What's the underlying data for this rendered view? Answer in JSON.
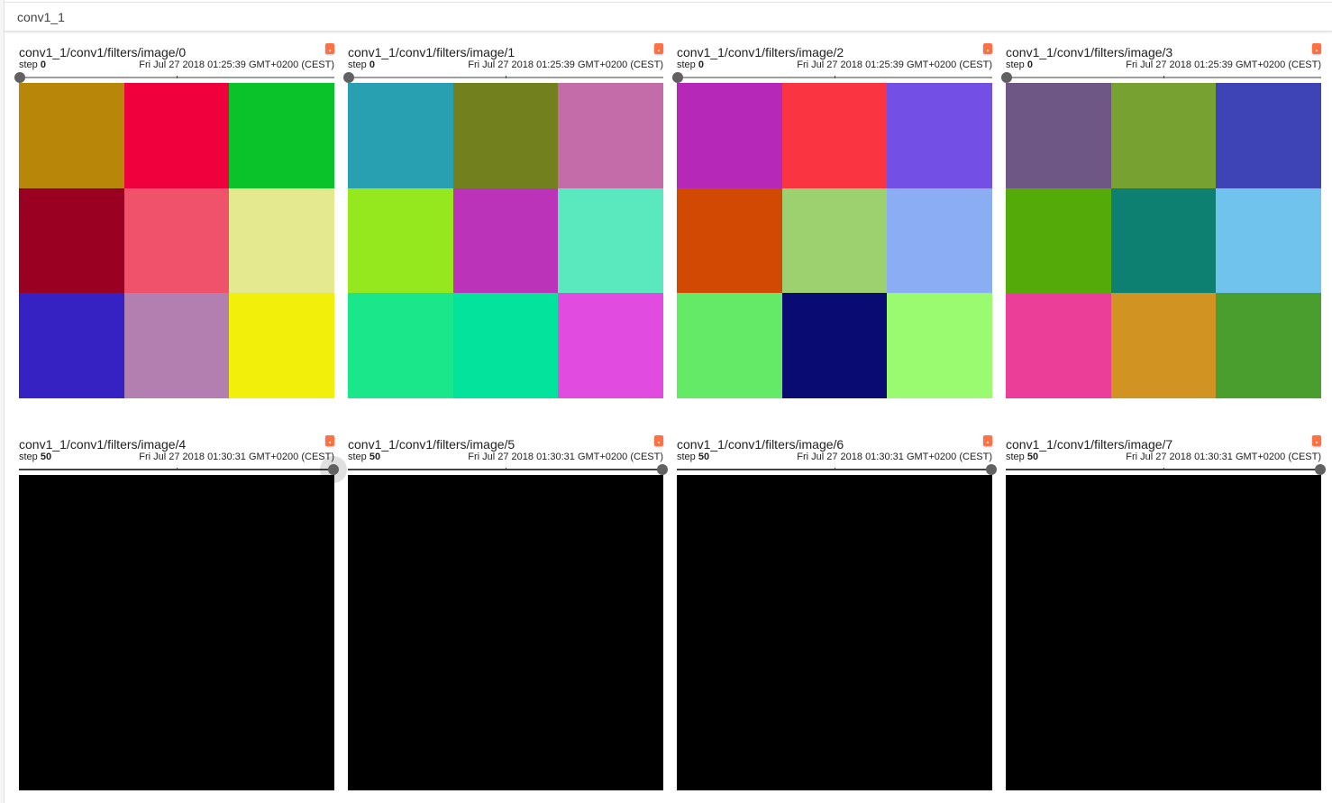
{
  "category": {
    "title": "conv1_1"
  },
  "cards": [
    {
      "tag": "conv1_1/conv1/filters/image/0",
      "step_label": "step",
      "step": "0",
      "wall_time": "Fri Jul 27 2018 01:25:39 GMT+0200 (CEST)",
      "slider_position": "start",
      "pixels": [
        "#b8870a",
        "#f0003c",
        "#0ac229",
        "#990022",
        "#f0526b",
        "#e4e88f",
        "#3622c2",
        "#b37fb0",
        "#f2ef0a"
      ]
    },
    {
      "tag": "conv1_1/conv1/filters/image/1",
      "step_label": "step",
      "step": "0",
      "wall_time": "Fri Jul 27 2018 01:25:39 GMT+0200 (CEST)",
      "slider_position": "start",
      "pixels": [
        "#29a0b2",
        "#73801e",
        "#c46ba9",
        "#96e81e",
        "#bb33b8",
        "#5ae8bf",
        "#19e78a",
        "#04e39c",
        "#e14be0"
      ]
    },
    {
      "tag": "conv1_1/conv1/filters/image/2",
      "step_label": "step",
      "step": "0",
      "wall_time": "Fri Jul 27 2018 01:25:39 GMT+0200 (CEST)",
      "slider_position": "start",
      "pixels": [
        "#b628b8",
        "#fa3440",
        "#744fe6",
        "#d14903",
        "#9dd06f",
        "#8aadf4",
        "#64ea67",
        "#0a0a73",
        "#9afa70"
      ]
    },
    {
      "tag": "conv1_1/conv1/filters/image/3",
      "step_label": "step",
      "step": "0",
      "wall_time": "Fri Jul 27 2018 01:25:39 GMT+0200 (CEST)",
      "slider_position": "start",
      "pixels": [
        "#6e5685",
        "#77a232",
        "#3e44b5",
        "#54aa08",
        "#0e8071",
        "#70c3ec",
        "#eb3e98",
        "#d19322",
        "#4a9e2d"
      ]
    },
    {
      "tag": "conv1_1/conv1/filters/image/4",
      "step_label": "step",
      "step": "50",
      "wall_time": "Fri Jul 27 2018 01:30:31 GMT+0200 (CEST)",
      "slider_position": "end",
      "slider_focused": true,
      "pixels": []
    },
    {
      "tag": "conv1_1/conv1/filters/image/5",
      "step_label": "step",
      "step": "50",
      "wall_time": "Fri Jul 27 2018 01:30:31 GMT+0200 (CEST)",
      "slider_position": "end",
      "pixels": []
    },
    {
      "tag": "conv1_1/conv1/filters/image/6",
      "step_label": "step",
      "step": "50",
      "wall_time": "Fri Jul 27 2018 01:30:31 GMT+0200 (CEST)",
      "slider_position": "end",
      "pixels": []
    },
    {
      "tag": "conv1_1/conv1/filters/image/7",
      "step_label": "step",
      "step": "50",
      "wall_time": "Fri Jul 27 2018 01:30:31 GMT+0200 (CEST)",
      "slider_position": "end",
      "pixels": []
    }
  ],
  "colors": {
    "expand_button": "#ff7043",
    "image_background": "#000000"
  },
  "icons": {
    "expand": "expand-icon"
  }
}
